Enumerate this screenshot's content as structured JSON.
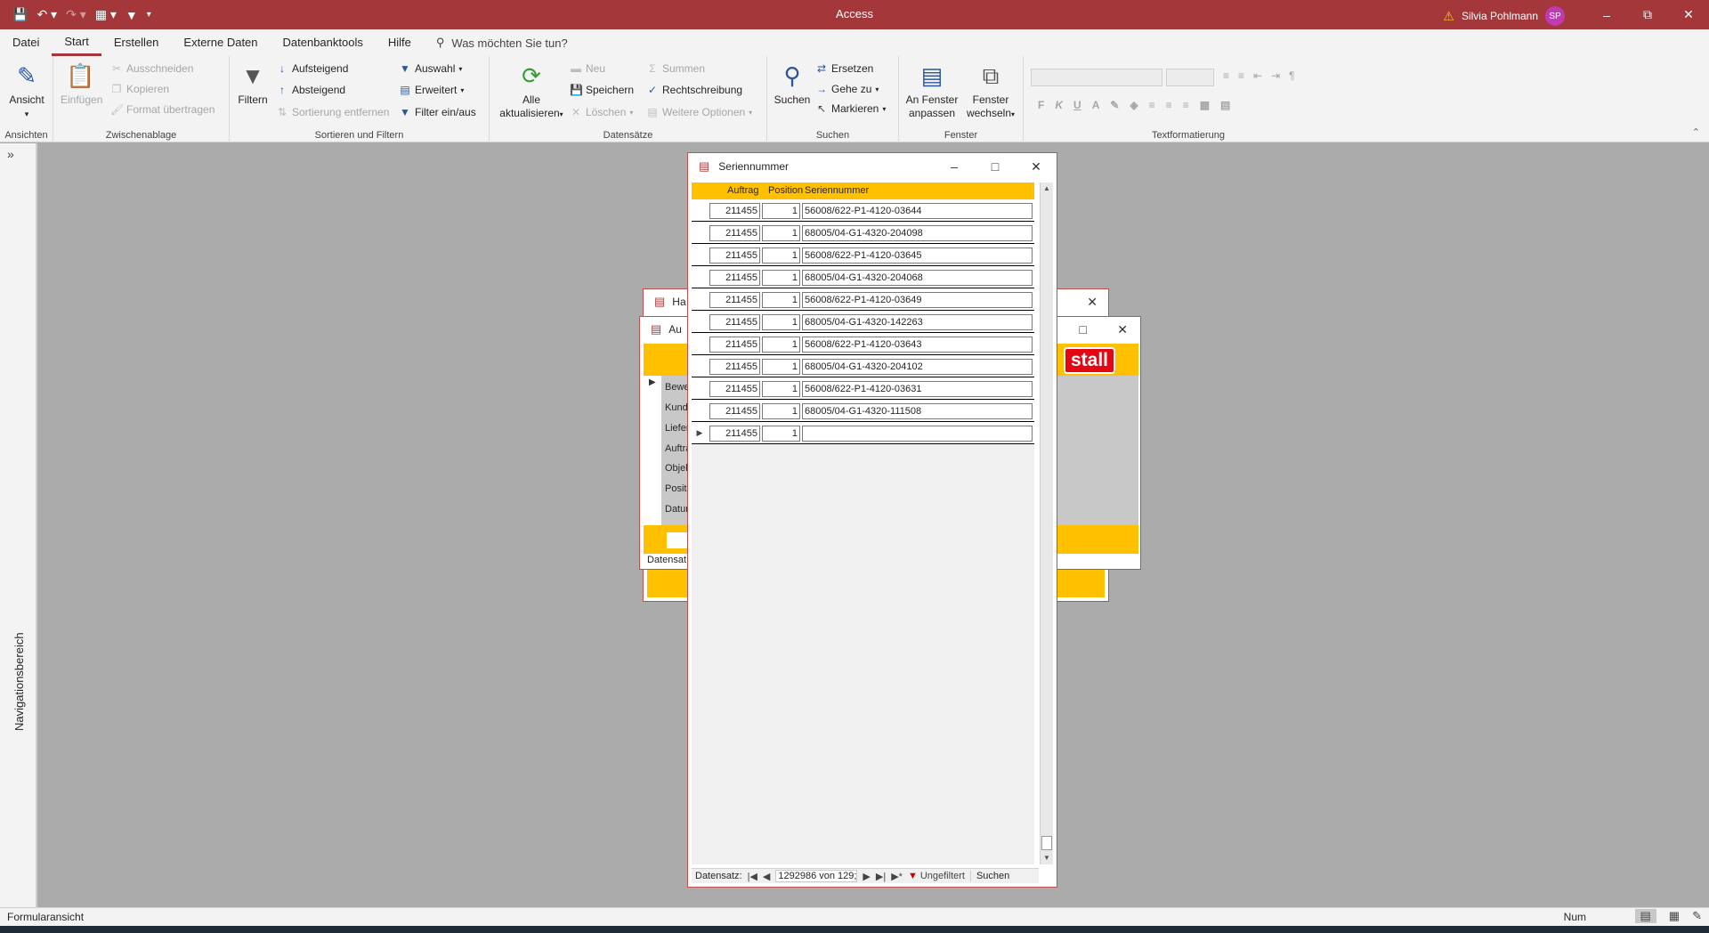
{
  "app": {
    "title": "Access",
    "user_name": "Silvia Pohlmann",
    "user_initials": "SP"
  },
  "menu": {
    "tabs": [
      "Datei",
      "Start",
      "Erstellen",
      "Externe Daten",
      "Datenbanktools",
      "Hilfe"
    ],
    "active_tab": "Start",
    "tell_me": "Was möchten Sie tun?"
  },
  "ribbon": {
    "ansichten": {
      "label": "Ansichten",
      "ansicht": "Ansicht"
    },
    "zwischenablage": {
      "label": "Zwischenablage",
      "einfuegen": "Einfügen",
      "ausschneiden": "Ausschneiden",
      "kopieren": "Kopieren",
      "format": "Format übertragen"
    },
    "sortieren": {
      "label": "Sortieren und Filtern",
      "filtern": "Filtern",
      "aufsteigend": "Aufsteigend",
      "absteigend": "Absteigend",
      "sortierung_entfernen": "Sortierung entfernen",
      "auswahl": "Auswahl",
      "erweitert": "Erweitert",
      "filter_einaus": "Filter ein/aus"
    },
    "datensaetze": {
      "label": "Datensätze",
      "alle": "Alle",
      "aktualisieren": "aktualisieren",
      "neu": "Neu",
      "speichern": "Speichern",
      "loeschen": "Löschen",
      "summen": "Summen",
      "rechtschreibung": "Rechtschreibung",
      "weitere": "Weitere Optionen"
    },
    "suchen": {
      "label": "Suchen",
      "suchen": "Suchen",
      "ersetzen": "Ersetzen",
      "gehe_zu": "Gehe zu",
      "markieren": "Markieren"
    },
    "fenster": {
      "label": "Fenster",
      "an_fenster": "An Fenster",
      "anpassen": "anpassen",
      "fenster": "Fenster",
      "wechseln": "wechseln"
    },
    "text": {
      "label": "Textformatierung",
      "bold": "F",
      "italic": "K",
      "underline": "U"
    }
  },
  "navpane": {
    "label": "Navigationsbereich"
  },
  "background_windows": {
    "win1_title": "Ha",
    "win2_title": "Au",
    "logo_text": "stall",
    "field_labels": [
      "Bewe",
      "Kunde",
      "Liefer",
      "Auftra",
      "Objek",
      "Positi",
      "Datum"
    ],
    "status": "Datensat"
  },
  "dialog": {
    "title": "Seriennummer",
    "columns": {
      "auftrag": "Auftrag",
      "position": "Position",
      "seriennummer": "Seriennummer"
    },
    "rows": [
      {
        "auftrag": "211455",
        "position": "1",
        "seriennummer": "56008/622-P1-4120-03644"
      },
      {
        "auftrag": "211455",
        "position": "1",
        "seriennummer": "68005/04-G1-4320-204098"
      },
      {
        "auftrag": "211455",
        "position": "1",
        "seriennummer": "56008/622-P1-4120-03645"
      },
      {
        "auftrag": "211455",
        "position": "1",
        "seriennummer": "68005/04-G1-4320-204068"
      },
      {
        "auftrag": "211455",
        "position": "1",
        "seriennummer": "56008/622-P1-4120-03649"
      },
      {
        "auftrag": "211455",
        "position": "1",
        "seriennummer": "68005/04-G1-4320-142263"
      },
      {
        "auftrag": "211455",
        "position": "1",
        "seriennummer": "56008/622-P1-4120-03643"
      },
      {
        "auftrag": "211455",
        "position": "1",
        "seriennummer": "68005/04-G1-4320-204102"
      },
      {
        "auftrag": "211455",
        "position": "1",
        "seriennummer": "56008/622-P1-4120-03631"
      },
      {
        "auftrag": "211455",
        "position": "1",
        "seriennummer": "68005/04-G1-4320-111508"
      },
      {
        "auftrag": "211455",
        "position": "1",
        "seriennummer": ""
      }
    ],
    "nav": {
      "label": "Datensatz:",
      "position": "1292986 von 129;",
      "filter": "Ungefiltert",
      "search": "Suchen"
    }
  },
  "statusbar": {
    "left": "Formularansicht",
    "num": "Num"
  },
  "colors": {
    "title_bar": "#a4373a",
    "header_yellow": "#ffc000",
    "logo_red": "#e30613"
  }
}
